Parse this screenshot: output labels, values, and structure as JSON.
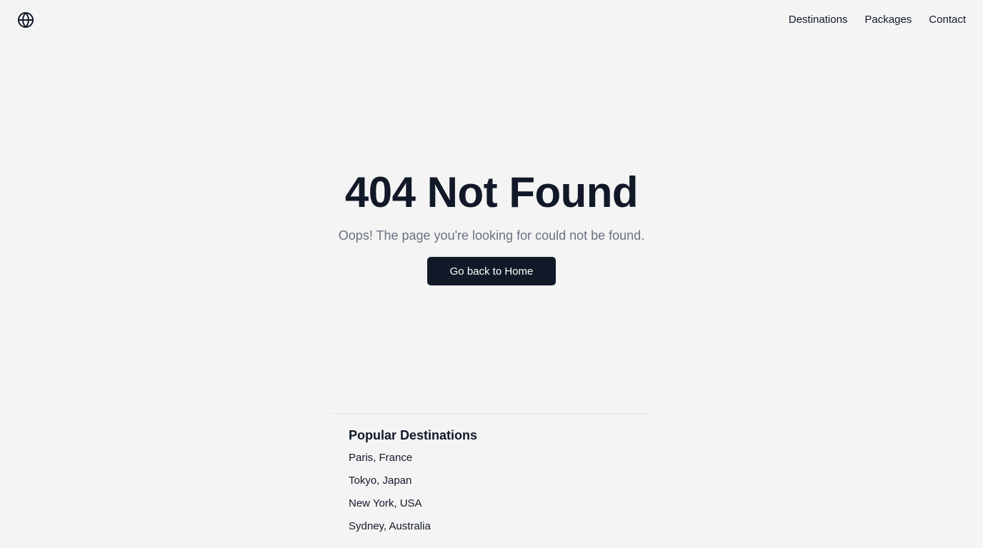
{
  "header": {
    "logo_icon": "globe-icon",
    "nav": [
      {
        "label": "Destinations"
      },
      {
        "label": "Packages"
      },
      {
        "label": "Contact"
      }
    ]
  },
  "hero": {
    "title": "404 Not Found",
    "message": "Oops! The page you're looking for could not be found.",
    "button_label": "Go back to Home"
  },
  "popular": {
    "heading": "Popular Destinations",
    "items": [
      {
        "label": "Paris, France"
      },
      {
        "label": "Tokyo, Japan"
      },
      {
        "label": "New York, USA"
      },
      {
        "label": "Sydney, Australia"
      }
    ]
  },
  "colors": {
    "background": "#f4f4f4",
    "text": "#111827",
    "muted": "#6b7280",
    "button_bg": "#111827",
    "button_text": "#ffffff"
  }
}
